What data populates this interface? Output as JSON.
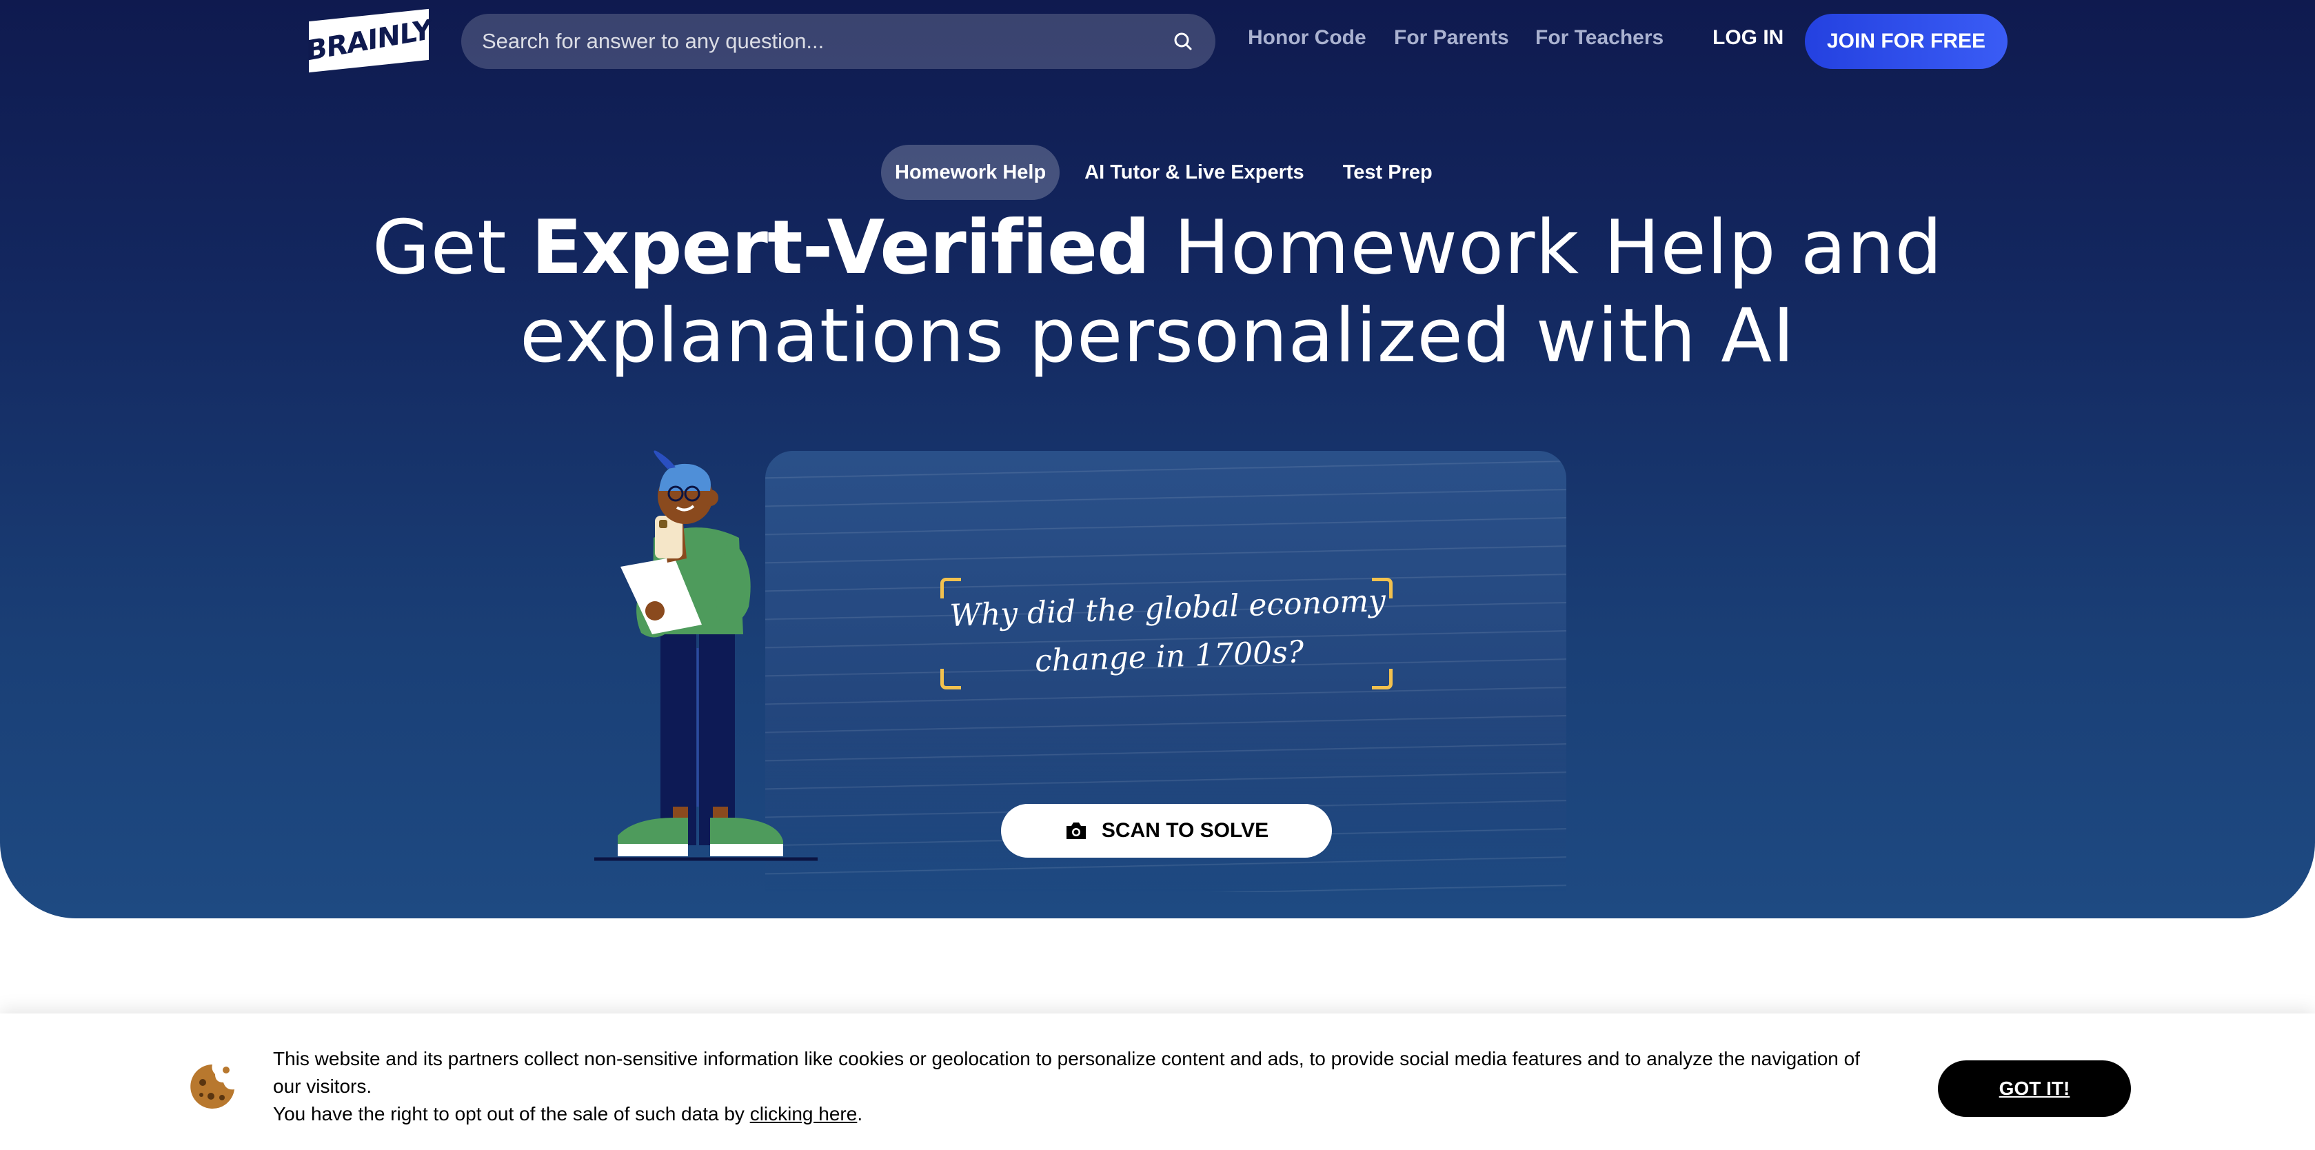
{
  "header": {
    "logo_text": "BRAINLY",
    "search": {
      "placeholder": "Search for answer to any question..."
    },
    "nav": [
      "Honor Code",
      "For Parents",
      "For Teachers"
    ],
    "login_label": "LOG IN",
    "join_label": "JOIN FOR FREE"
  },
  "tabs": [
    {
      "label": "Homework Help",
      "active": true
    },
    {
      "label": "AI Tutor & Live Experts",
      "active": false
    },
    {
      "label": "Test Prep",
      "active": false
    }
  ],
  "hero": {
    "headline_pre": "Get ",
    "headline_bold": "Expert-Verified",
    "headline_post": " Homework Help and",
    "headline_line2": "explanations personalized with AI",
    "question_line1": "Why did the global economy",
    "question_line2": "change in 1700s?",
    "scan_label": "SCAN TO SOLVE"
  },
  "cookie": {
    "text_line1": "This website and its partners collect non-sensitive information like cookies or geolocation to personalize content and ads, to provide social media features and to analyze the navigation of our visitors.",
    "text_line2_prefix": "You have the right to opt out of the sale of such data by ",
    "link_label": "clicking here",
    "text_line2_suffix": ".",
    "button_label": "GOT IT!"
  },
  "colors": {
    "hero_top": "#0f1a4f",
    "hero_bottom": "#1e4a82",
    "accent_blue": "#2441e0",
    "bracket_yellow": "#f2c14e"
  }
}
